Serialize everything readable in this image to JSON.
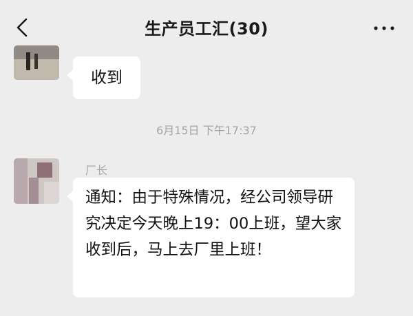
{
  "header": {
    "title": "生产员工汇(30)",
    "back_icon": "chevron-left-icon",
    "more_icon": "more-horizontal-icon"
  },
  "messages": [
    {
      "text": "收到"
    },
    {
      "timestamp": "6月15日 下午17:37"
    },
    {
      "sender": "厂长",
      "text": "通知：由于特殊情况，经公司领导研究决定今天晚上19：00上班，望大家收到后，马上去厂里上班！"
    }
  ],
  "colors": {
    "background": "#ededed",
    "bubble": "#ffffff",
    "meta_text": "#a3a3a3"
  }
}
